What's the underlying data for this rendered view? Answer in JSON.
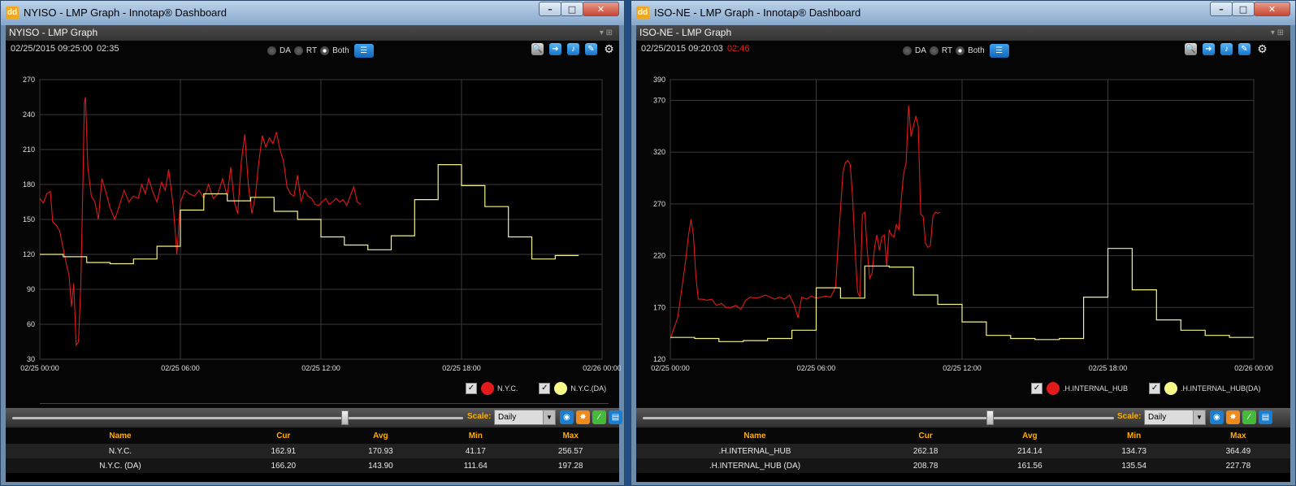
{
  "windows": [
    {
      "id": "left",
      "app_icon": "dd",
      "title": "NYISO - LMP Graph - Innotap® Dashboard",
      "panel_title": "NYISO - LMP Graph",
      "timestamp": "02/25/2015 09:25:00",
      "countdown": "02:35",
      "countdown_red": false,
      "radio_labels": [
        "DA",
        "RT",
        "Both"
      ],
      "selected_mode": "Both",
      "chart_data": {
        "type": "line",
        "y_ticks": [
          270,
          240,
          210,
          180,
          150,
          120,
          90,
          60,
          30
        ],
        "ylim": [
          30,
          270
        ],
        "x_tick_labels": [
          "02/25 00:00",
          "02/25 06:00",
          "02/25 12:00",
          "02/25 18:00",
          "02/26 00:00"
        ],
        "xlim_hours": [
          0,
          24
        ],
        "grid": true,
        "series": [
          {
            "name": "N.Y.C.",
            "color": "#e21a1a",
            "style": "line",
            "points": [
              [
                0,
                168
              ],
              [
                0.15,
                164
              ],
              [
                0.3,
                172
              ],
              [
                0.45,
                174
              ],
              [
                0.55,
                148
              ],
              [
                0.7,
                145
              ],
              [
                0.85,
                140
              ],
              [
                1.0,
                125
              ],
              [
                1.15,
                110
              ],
              [
                1.25,
                102
              ],
              [
                1.35,
                75
              ],
              [
                1.45,
                95
              ],
              [
                1.55,
                42
              ],
              [
                1.65,
                45
              ],
              [
                1.75,
                95
              ],
              [
                1.85,
                190
              ],
              [
                1.9,
                250
              ],
              [
                1.95,
                255
              ],
              [
                2.05,
                195
              ],
              [
                2.2,
                170
              ],
              [
                2.35,
                165
              ],
              [
                2.5,
                150
              ],
              [
                2.65,
                185
              ],
              [
                2.8,
                175
              ],
              [
                3.0,
                160
              ],
              [
                3.2,
                150
              ],
              [
                3.4,
                162
              ],
              [
                3.6,
                175
              ],
              [
                3.8,
                165
              ],
              [
                4.0,
                170
              ],
              [
                4.2,
                168
              ],
              [
                4.35,
                180
              ],
              [
                4.5,
                172
              ],
              [
                4.65,
                185
              ],
              [
                4.8,
                175
              ],
              [
                5.0,
                165
              ],
              [
                5.2,
                182
              ],
              [
                5.35,
                175
              ],
              [
                5.5,
                193
              ],
              [
                5.7,
                160
              ],
              [
                5.85,
                120
              ],
              [
                6.0,
                165
              ],
              [
                6.2,
                175
              ],
              [
                6.4,
                172
              ],
              [
                6.6,
                170
              ],
              [
                6.8,
                175
              ],
              [
                7.0,
                168
              ],
              [
                7.2,
                180
              ],
              [
                7.4,
                168
              ],
              [
                7.6,
                172
              ],
              [
                7.8,
                185
              ],
              [
                8.0,
                170
              ],
              [
                8.15,
                195
              ],
              [
                8.3,
                165
              ],
              [
                8.45,
                155
              ],
              [
                8.6,
                200
              ],
              [
                8.75,
                223
              ],
              [
                8.9,
                180
              ],
              [
                9.05,
                155
              ],
              [
                9.2,
                170
              ],
              [
                9.35,
                200
              ],
              [
                9.5,
                222
              ],
              [
                9.65,
                212
              ],
              [
                9.8,
                220
              ],
              [
                9.95,
                215
              ],
              [
                10.1,
                225
              ],
              [
                10.25,
                210
              ],
              [
                10.4,
                200
              ],
              [
                10.55,
                178
              ],
              [
                10.7,
                172
              ],
              [
                10.85,
                170
              ],
              [
                11.0,
                188
              ],
              [
                11.15,
                165
              ],
              [
                11.3,
                175
              ],
              [
                11.45,
                170
              ],
              [
                11.6,
                168
              ],
              [
                11.75,
                163
              ],
              [
                11.9,
                162
              ],
              [
                12.05,
                165
              ],
              [
                12.2,
                168
              ],
              [
                12.35,
                163
              ],
              [
                12.5,
                165
              ],
              [
                12.65,
                168
              ],
              [
                12.8,
                165
              ],
              [
                12.95,
                167
              ],
              [
                13.1,
                162
              ],
              [
                13.25,
                170
              ],
              [
                13.4,
                178
              ],
              [
                13.55,
                165
              ],
              [
                13.7,
                163
              ]
            ]
          },
          {
            "name": "N.Y.C.(DA)",
            "color": "#f2f28c",
            "style": "step",
            "values": [
              120,
              118,
              113,
              112,
              116,
              127,
              158,
              172,
              166,
              169,
              157,
              150,
              135,
              128,
              124,
              136,
              167,
              197,
              179,
              161,
              135,
              116,
              119
            ]
          }
        ]
      },
      "legend": [
        {
          "label": "N.Y.C.",
          "color": "#e21a1a",
          "checked": true
        },
        {
          "label": "N.Y.C.(DA)",
          "color": "#f7f78a",
          "checked": true
        }
      ],
      "controls": {
        "scale_label": "Scale:",
        "scale_value": "Daily",
        "slider_position": 0.73
      },
      "stats": {
        "columns": [
          "Name",
          "Cur",
          "Avg",
          "Min",
          "Max"
        ],
        "rows": [
          [
            "N.Y.C.",
            "162.91",
            "170.93",
            "41.17",
            "256.57"
          ],
          [
            "N.Y.C. (DA)",
            "166.20",
            "143.90",
            "111.64",
            "197.28"
          ]
        ]
      }
    },
    {
      "id": "right",
      "app_icon": "dd",
      "title": "ISO-NE - LMP Graph - Innotap® Dashboard",
      "panel_title": "ISO-NE - LMP Graph",
      "timestamp": "02/25/2015 09:20:03",
      "countdown": "02:46",
      "countdown_red": true,
      "radio_labels": [
        "DA",
        "RT",
        "Both"
      ],
      "selected_mode": "Both",
      "chart_data": {
        "type": "line",
        "y_ticks": [
          390,
          370,
          320,
          270,
          220,
          170,
          120
        ],
        "ylim": [
          120,
          390
        ],
        "x_tick_labels": [
          "02/25 00:00",
          "02/25 06:00",
          "02/25 12:00",
          "02/25 18:00",
          "02/26 00:00"
        ],
        "xlim_hours": [
          0,
          24
        ],
        "grid": true,
        "series": [
          {
            "name": ".H.INTERNAL_HUB",
            "color": "#e21a1a",
            "style": "line",
            "points": [
              [
                0,
                140
              ],
              [
                0.15,
                150
              ],
              [
                0.3,
                160
              ],
              [
                0.45,
                185
              ],
              [
                0.6,
                210
              ],
              [
                0.75,
                240
              ],
              [
                0.85,
                255
              ],
              [
                0.95,
                240
              ],
              [
                1.05,
                200
              ],
              [
                1.15,
                178
              ],
              [
                1.3,
                178
              ],
              [
                1.5,
                177
              ],
              [
                1.7,
                178
              ],
              [
                1.9,
                172
              ],
              [
                2.1,
                174
              ],
              [
                2.3,
                170
              ],
              [
                2.5,
                170
              ],
              [
                2.7,
                172
              ],
              [
                2.9,
                168
              ],
              [
                3.1,
                177
              ],
              [
                3.3,
                180
              ],
              [
                3.5,
                179
              ],
              [
                3.7,
                180
              ],
              [
                3.9,
                182
              ],
              [
                4.1,
                180
              ],
              [
                4.3,
                178
              ],
              [
                4.5,
                180
              ],
              [
                4.7,
                178
              ],
              [
                4.9,
                182
              ],
              [
                5.1,
                172
              ],
              [
                5.25,
                160
              ],
              [
                5.4,
                180
              ],
              [
                5.6,
                178
              ],
              [
                5.8,
                181
              ],
              [
                6.0,
                179
              ],
              [
                6.2,
                180
              ],
              [
                6.4,
                181
              ],
              [
                6.6,
                180
              ],
              [
                6.8,
                190
              ],
              [
                6.9,
                230
              ],
              [
                7.0,
                265
              ],
              [
                7.1,
                300
              ],
              [
                7.2,
                310
              ],
              [
                7.3,
                312
              ],
              [
                7.4,
                308
              ],
              [
                7.5,
                275
              ],
              [
                7.6,
                225
              ],
              [
                7.7,
                185
              ],
              [
                7.8,
                180
              ],
              [
                7.9,
                260
              ],
              [
                8.0,
                262
              ],
              [
                8.1,
                225
              ],
              [
                8.2,
                198
              ],
              [
                8.3,
                203
              ],
              [
                8.4,
                228
              ],
              [
                8.5,
                240
              ],
              [
                8.6,
                225
              ],
              [
                8.7,
                238
              ],
              [
                8.8,
                240
              ],
              [
                8.9,
                210
              ],
              [
                9.0,
                245
              ],
              [
                9.1,
                240
              ],
              [
                9.2,
                238
              ],
              [
                9.3,
                250
              ],
              [
                9.4,
                245
              ],
              [
                9.5,
                275
              ],
              [
                9.6,
                300
              ],
              [
                9.7,
                310
              ],
              [
                9.8,
                365
              ],
              [
                9.9,
                335
              ],
              [
                10.0,
                345
              ],
              [
                10.1,
                355
              ],
              [
                10.2,
                345
              ],
              [
                10.3,
                260
              ],
              [
                10.4,
                258
              ],
              [
                10.5,
                232
              ],
              [
                10.6,
                228
              ],
              [
                10.7,
                230
              ],
              [
                10.8,
                258
              ],
              [
                10.9,
                262
              ],
              [
                11.0,
                261
              ],
              [
                11.1,
                262
              ]
            ]
          },
          {
            "name": ".H.INTERNAL_HUB(DA)",
            "color": "#f2f28c",
            "style": "step",
            "values": [
              141,
              140,
              137,
              138,
              140,
              148,
              189,
              179,
              210,
              209,
              182,
              173,
              156,
              143,
              140,
              139,
              140,
              180,
              227,
              187,
              158,
              148,
              143,
              141
            ]
          }
        ]
      },
      "legend": [
        {
          "label": ".H.INTERNAL_HUB",
          "color": "#e21a1a",
          "checked": true
        },
        {
          "label": ".H.INTERNAL_HUB(DA)",
          "color": "#f7f78a",
          "checked": true
        }
      ],
      "controls": {
        "scale_label": "Scale:",
        "scale_value": "Daily",
        "slider_position": 0.73
      },
      "stats": {
        "columns": [
          "Name",
          "Cur",
          "Avg",
          "Min",
          "Max"
        ],
        "rows": [
          [
            ".H.INTERNAL_HUB",
            "262.18",
            "214.14",
            "134.73",
            "364.49"
          ],
          [
            ".H.INTERNAL_HUB (DA)",
            "208.78",
            "161.56",
            "135.54",
            "227.78"
          ]
        ]
      }
    }
  ]
}
